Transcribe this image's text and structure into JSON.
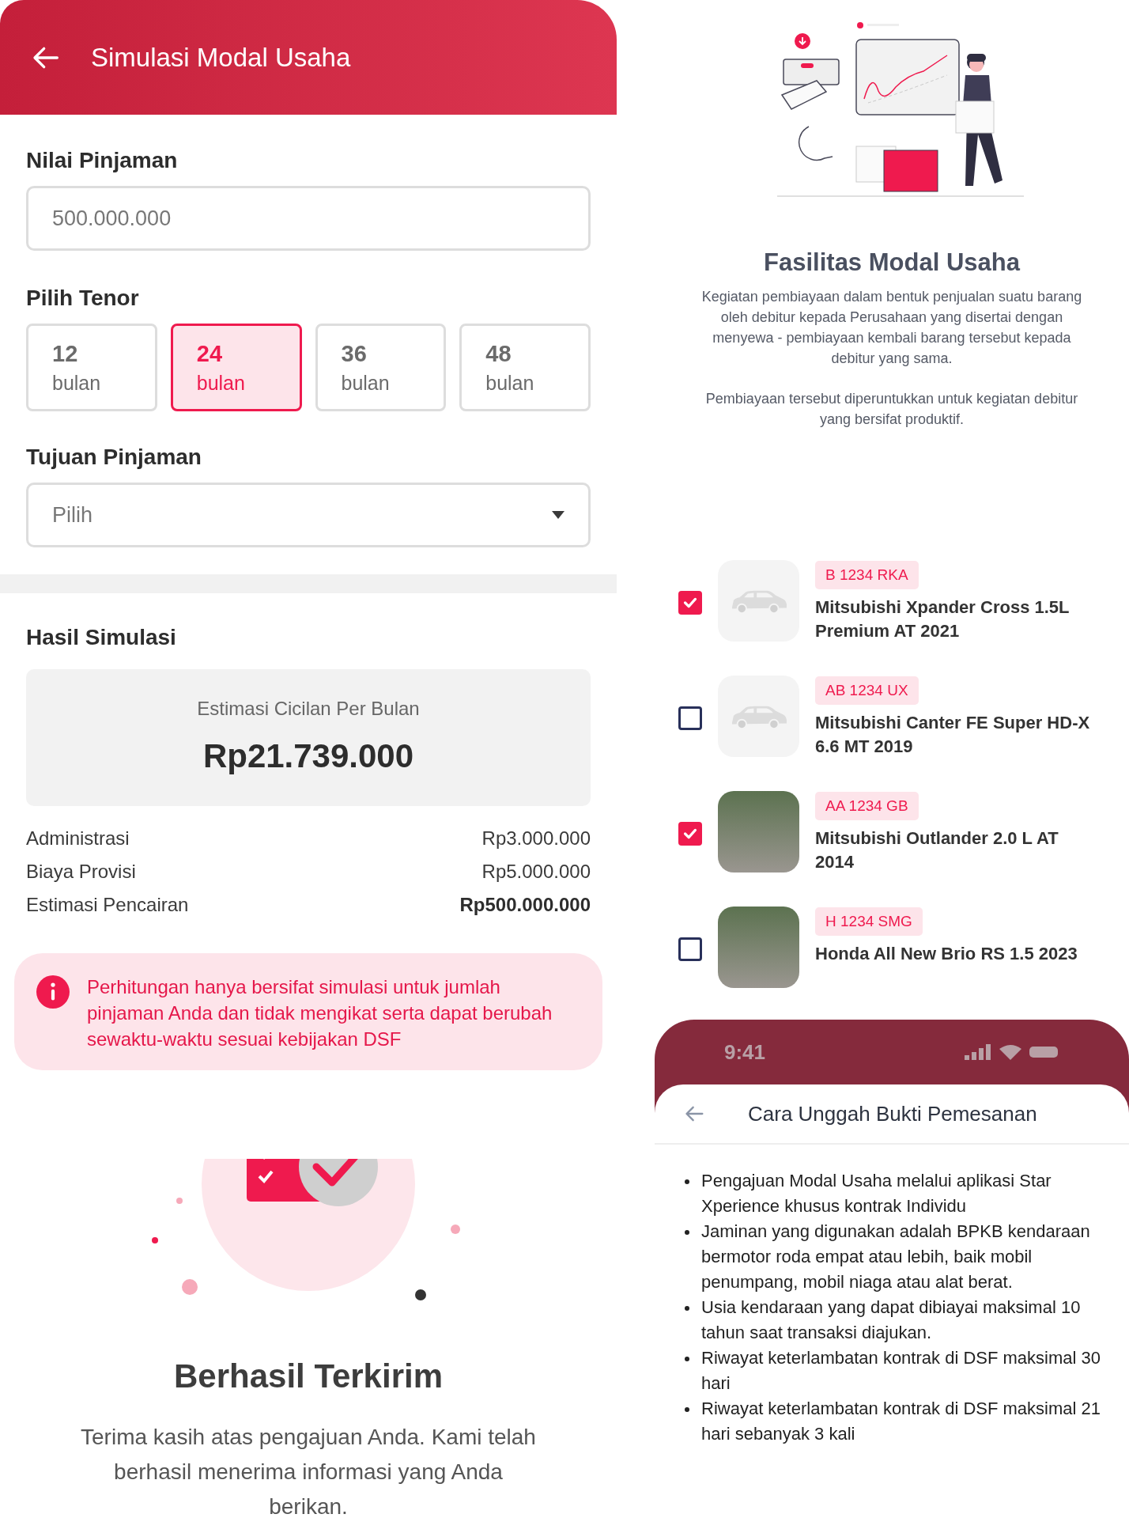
{
  "simulation": {
    "title": "Simulasi Modal Usaha",
    "loan_amount": {
      "label": "Nilai Pinjaman",
      "placeholder": "500.000.000"
    },
    "tenor": {
      "label": "Pilih Tenor",
      "options": [
        {
          "number": "12",
          "unit": "bulan",
          "selected": false
        },
        {
          "number": "24",
          "unit": "bulan",
          "selected": true
        },
        {
          "number": "36",
          "unit": "bulan",
          "selected": false
        },
        {
          "number": "48",
          "unit": "bulan",
          "selected": false
        }
      ]
    },
    "purpose": {
      "label": "Tujuan Pinjaman",
      "placeholder": "Pilih"
    },
    "result": {
      "title": "Hasil Simulasi",
      "estimate_label": "Estimasi Cicilan Per Bulan",
      "estimate_value": "Rp21.739.000",
      "rows": [
        {
          "label": "Administrasi",
          "value": "Rp3.000.000",
          "bold": false
        },
        {
          "label": "Biaya Provisi",
          "value": "Rp5.000.000",
          "bold": false
        },
        {
          "label": "Estimasi Pencairan",
          "value": "Rp500.000.000",
          "bold": true
        }
      ],
      "notice": "Perhitungan hanya bersifat simulasi untuk jumlah pinjaman Anda dan tidak mengikat serta dapat berubah sewaktu-waktu sesuai kebijakan DSF"
    }
  },
  "success": {
    "title": "Berhasil Terkirim",
    "message": "Terima kasih atas pengajuan Anda. Kami telah berhasil menerima informasi yang Anda berikan."
  },
  "facility": {
    "title": "Fasilitas Modal Usaha",
    "paragraphs": [
      "Kegiatan pembiayaan dalam bentuk penjualan suatu barang oleh debitur kepada Perusahaan yang disertai dengan menyewa - pembiayaan kembali barang tersebut kepada debitur yang sama.",
      "Pembiayaan tersebut diperuntukkan untuk kegiatan debitur yang bersifat produktif."
    ]
  },
  "vehicles": [
    {
      "plate": "B 1234 RKA",
      "name": "Mitsubishi Xpander Cross 1.5L Premium AT 2021",
      "checked": true,
      "kind": "placeholder"
    },
    {
      "plate": "AB 1234 UX",
      "name": "Mitsubishi Canter FE Super HD-X 6.6 MT 2019",
      "checked": false,
      "kind": "placeholder"
    },
    {
      "plate": "AA 1234 GB",
      "name": "Mitsubishi Outlander 2.0 L AT 2014",
      "checked": true,
      "kind": "photo"
    },
    {
      "plate": "H 1234 SMG",
      "name": "Honda All New Brio RS 1.5 2023",
      "checked": false,
      "kind": "photo"
    }
  ],
  "upload_guide": {
    "status_time": "9:41",
    "title": "Cara Unggah Bukti Pemesanan",
    "bullets": [
      "Pengajuan Modal Usaha melalui aplikasi Star Xperience khusus kontrak Individu",
      "Jaminan yang digunakan adalah BPKB kendaraan bermotor roda empat atau lebih, baik mobil penumpang, mobil niaga atau alat berat.",
      "Usia kendaraan yang dapat dibiayai maksimal 10 tahun saat transaksi diajukan.",
      "Riwayat keterlambatan kontrak di DSF maksimal 30 hari",
      "Riwayat keterlambatan kontrak di DSF maksimal 21 hari sebanyak 3 kali"
    ]
  }
}
